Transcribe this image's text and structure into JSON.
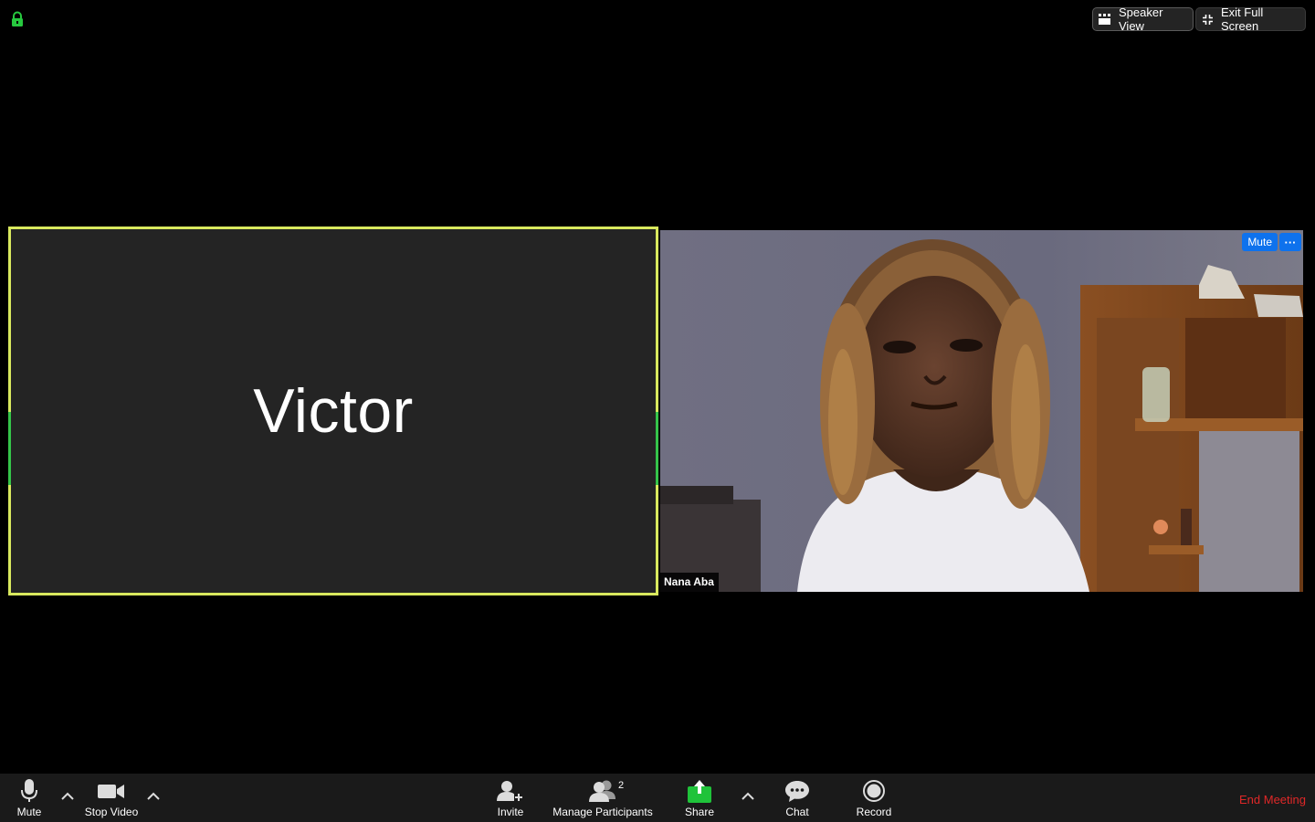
{
  "top_bar": {
    "speaker_view_label": "Speaker View",
    "exit_full_screen_label": "Exit Full Screen"
  },
  "tiles": {
    "victor": {
      "name": "Victor"
    },
    "nana": {
      "name": "Nana Aba",
      "mute_label": "Mute",
      "more_label": "···"
    }
  },
  "toolbar": {
    "mute_label": "Mute",
    "stop_video_label": "Stop Video",
    "invite_label": "Invite",
    "manage_participants_label": "Manage Participants",
    "participants_count": "2",
    "share_label": "Share",
    "chat_label": "Chat",
    "record_label": "Record",
    "end_meeting_label": "End Meeting"
  },
  "colors": {
    "active_speaker_border": "#d9e95e",
    "share_green": "#1fc33a",
    "mute_blue": "#0e72ed",
    "end_meeting_red": "#e02828",
    "lock_green": "#27c93f"
  }
}
